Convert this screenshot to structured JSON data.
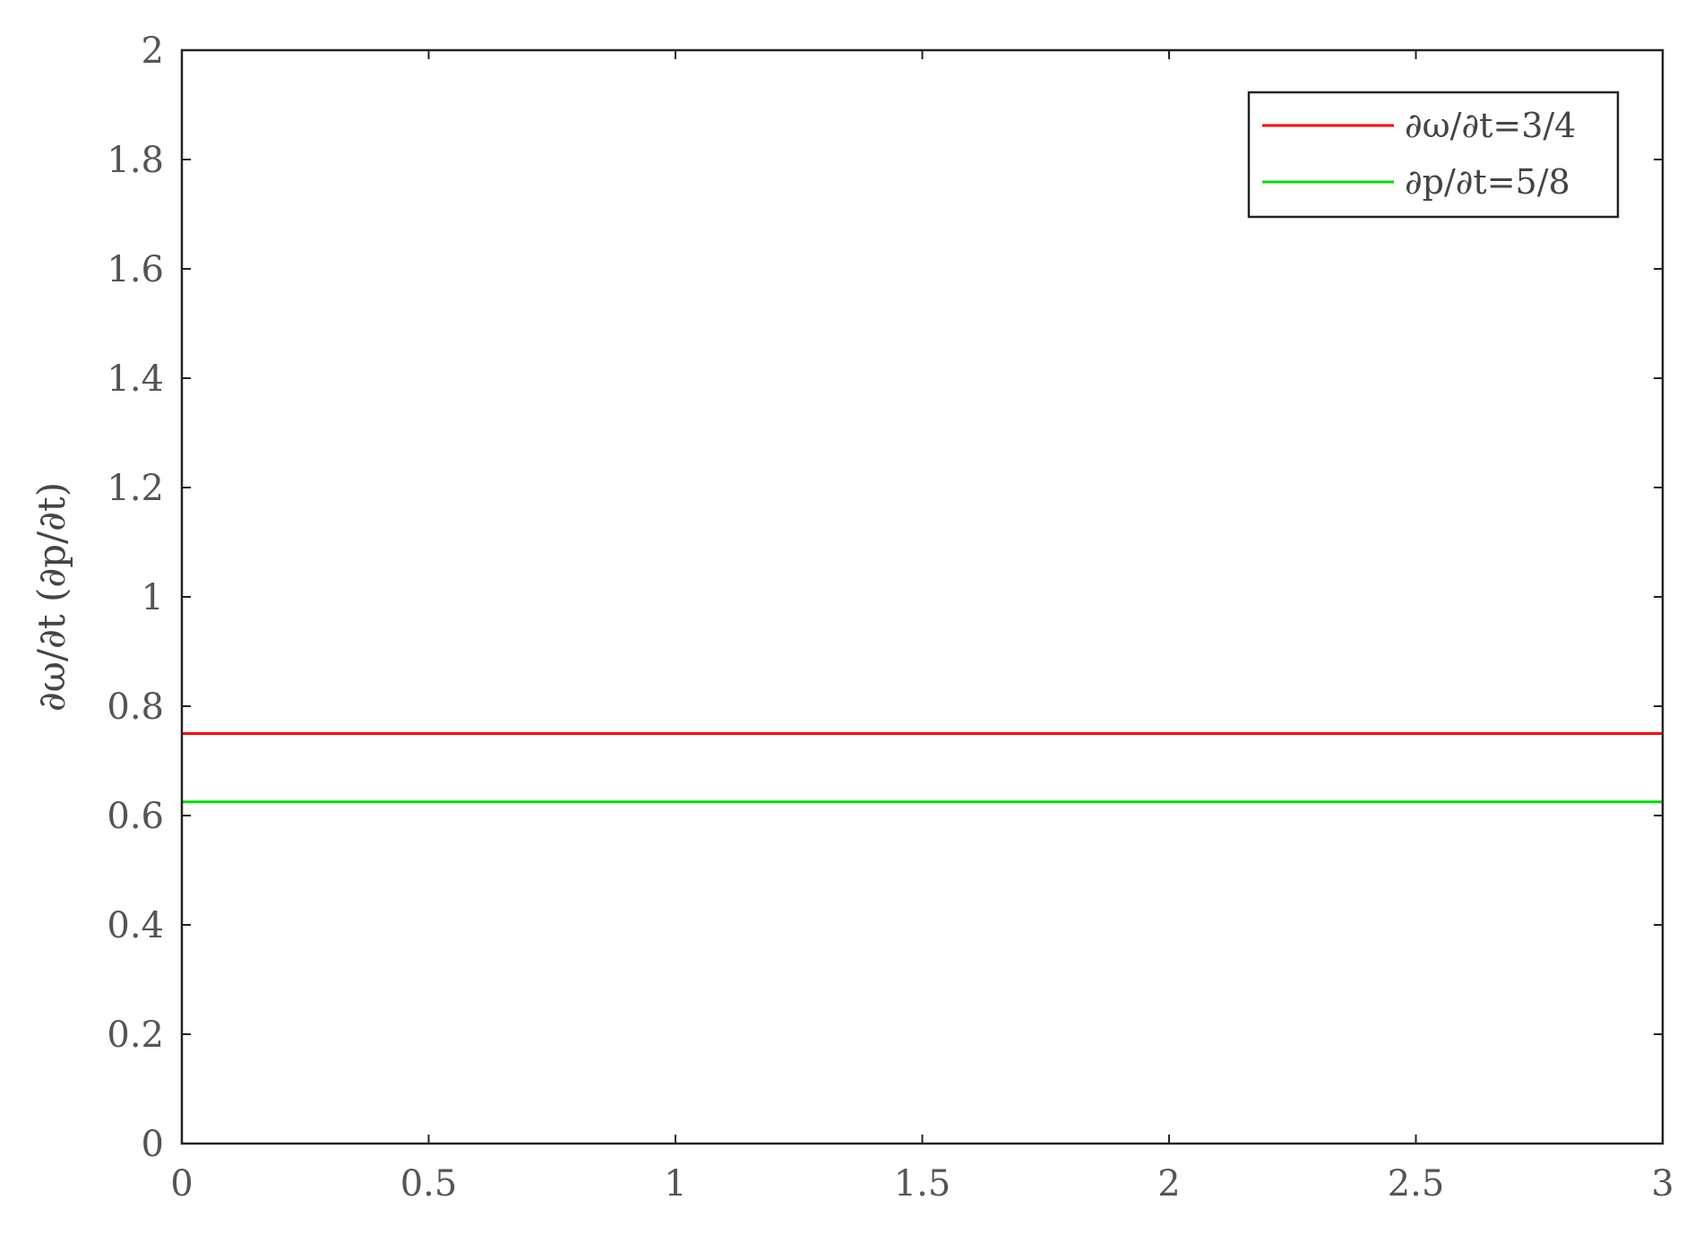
{
  "chart_data": {
    "type": "line",
    "title": "",
    "xlabel": "",
    "ylabel": "∂ω/∂t (∂p/∂t)",
    "xlim": [
      0,
      3
    ],
    "ylim": [
      0,
      2
    ],
    "xticks": [
      0,
      0.5,
      1,
      1.5,
      2,
      2.5,
      3
    ],
    "xtick_labels": [
      "0",
      "0.5",
      "1",
      "1.5",
      "2",
      "2.5",
      "3"
    ],
    "yticks": [
      0,
      0.2,
      0.4,
      0.6,
      0.8,
      1,
      1.2,
      1.4,
      1.6,
      1.8,
      2
    ],
    "ytick_labels": [
      "0",
      "0.2",
      "0.4",
      "0.6",
      "0.8",
      "1",
      "1.2",
      "1.4",
      "1.6",
      "1.8",
      "2"
    ],
    "grid": false,
    "legend_position": "top-right",
    "series": [
      {
        "name": "∂ω/∂t=3/4",
        "color": "#ff0000",
        "x": [
          0,
          3
        ],
        "y": [
          0.75,
          0.75
        ]
      },
      {
        "name": "∂p/∂t=5/8",
        "color": "#00dd00",
        "x": [
          0,
          3
        ],
        "y": [
          0.625,
          0.625
        ]
      }
    ]
  }
}
